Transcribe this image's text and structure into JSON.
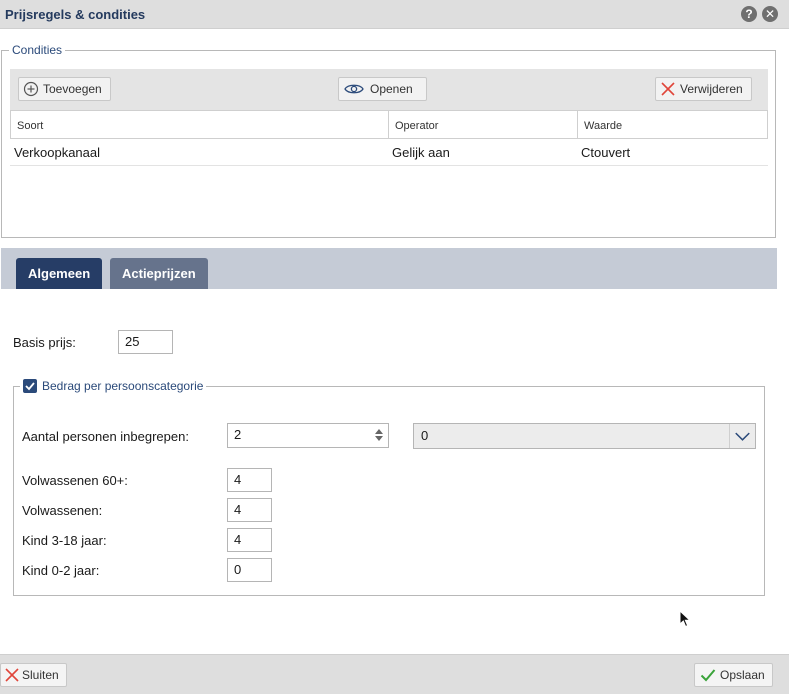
{
  "window": {
    "title": "Prijsregels & condities"
  },
  "conditions": {
    "legend": "Condities",
    "toolbar": {
      "add_label": "Toevoegen",
      "open_label": "Openen",
      "delete_label": "Verwijderen"
    },
    "columns": [
      "Soort",
      "Operator",
      "Waarde"
    ],
    "rows": [
      {
        "soort": "Verkoopkanaal",
        "operator": "Gelijk aan",
        "waarde": "Ctouvert"
      }
    ]
  },
  "tabs": [
    {
      "label": "Algemeen",
      "active": true
    },
    {
      "label": "Actieprijzen",
      "active": false
    }
  ],
  "general": {
    "base_price_label": "Basis prijs:",
    "base_price_value": "25",
    "per_category": {
      "legend": "Bedrag per persoonscategorie",
      "checked": true,
      "included_label": "Aantal personen inbegrepen:",
      "included_value": "2",
      "select_value": "0",
      "categories": [
        {
          "label": "Volwassenen 60+:",
          "value": "4"
        },
        {
          "label": "Volwassenen:",
          "value": "4"
        },
        {
          "label": "Kind 3-18 jaar:",
          "value": "4"
        },
        {
          "label": "Kind 0-2 jaar:",
          "value": "0"
        }
      ]
    }
  },
  "footer": {
    "close_label": "Sluiten",
    "save_label": "Opslaan"
  },
  "colors": {
    "accent": "#263d66",
    "tab_inactive": "#66738c",
    "delete_red": "#e0453a",
    "save_green": "#3aa33a"
  },
  "icons": [
    "help-icon",
    "close-icon",
    "add-circle-icon",
    "eye-icon",
    "x-delete-icon",
    "checkbox-icon",
    "chevron-down-icon",
    "checkmark-icon"
  ]
}
